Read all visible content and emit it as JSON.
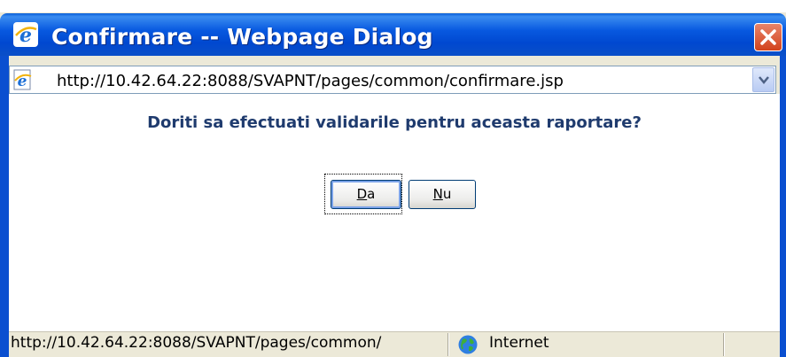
{
  "window": {
    "title": "Confirmare -- Webpage Dialog",
    "title_icon": "ie-icon",
    "close_icon": "close-icon"
  },
  "address_bar": {
    "url": "http://10.42.64.22:8088/SVAPNT/pages/common/confirmare.jsp",
    "page_icon": "ie-page-icon",
    "dropdown_icon": "chevron-down-icon"
  },
  "dialog": {
    "question": "Doriti sa efectuati validarile pentru aceasta raportare?",
    "buttons": {
      "yes_label_accel": "D",
      "yes_label_rest": "a",
      "no_label_accel": "N",
      "no_label_rest": "u"
    }
  },
  "status_bar": {
    "url": "http://10.42.64.22:8088/SVAPNT/pages/common/",
    "zone": "Internet",
    "zone_icon": "globe-icon"
  },
  "colors": {
    "titlebar": "#0054e3",
    "close_button": "#d2421c",
    "question_text": "#1f3b6e",
    "button_border": "#003c74"
  }
}
